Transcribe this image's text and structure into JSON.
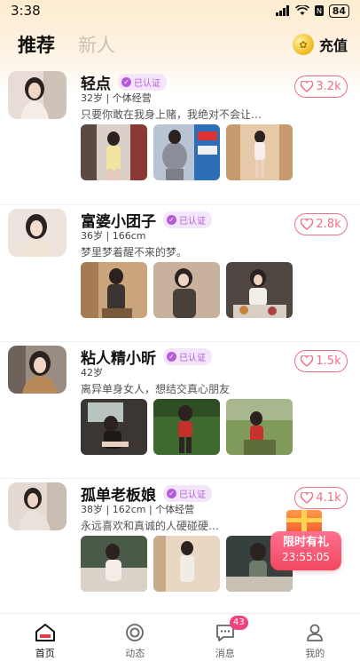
{
  "status_bar": {
    "time": "3:38",
    "battery": "84"
  },
  "header": {
    "tabs": [
      {
        "label": "推荐"
      },
      {
        "label": "新人"
      }
    ],
    "recharge_label": "充值"
  },
  "users": [
    {
      "name": "轻点",
      "verified_label": "已认证",
      "meta": "32岁 | 个体经营",
      "desc": "只要你敢在我身上赌，我绝对不会让…",
      "likes": "3.2k"
    },
    {
      "name": "富婆小团子",
      "verified_label": "已认证",
      "meta": "36岁 | 166cm",
      "desc": "梦里梦着醒不来的梦。",
      "likes": "2.8k"
    },
    {
      "name": "粘人精小昕",
      "verified_label": "已认证",
      "meta": "42岁",
      "desc": "离异单身女人，想结交真心朋友",
      "likes": "1.5k"
    },
    {
      "name": "孤单老板娘",
      "verified_label": "已认证",
      "meta": "38岁 | 162cm | 个体经营",
      "desc": "永远喜欢和真诚的人硬碰硬…",
      "likes": "4.1k"
    }
  ],
  "promo": {
    "title": "限时有礼",
    "countdown": "23:55:05"
  },
  "bottom_nav": [
    {
      "label": "首页",
      "icon": "home-icon"
    },
    {
      "label": "动态",
      "icon": "moments-icon"
    },
    {
      "label": "消息",
      "icon": "message-icon",
      "badge": "43"
    },
    {
      "label": "我的",
      "icon": "profile-icon"
    }
  ],
  "colors": {
    "accent_pink": "#ee6f86",
    "verified_purple": "#b65ad9",
    "badge": "#f0437b"
  }
}
